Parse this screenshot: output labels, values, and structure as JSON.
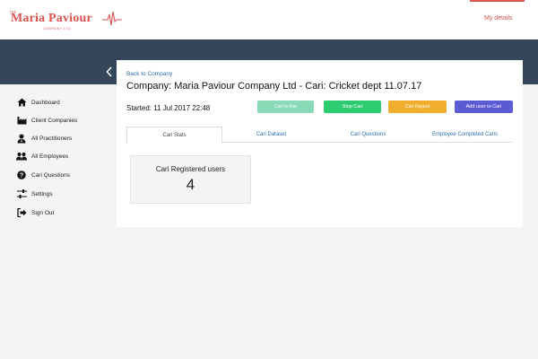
{
  "header": {
    "logo": {
      "the": "THE",
      "name": "Maria Paviour",
      "subtitle": "COMPANY LTD"
    },
    "my_details": "My details",
    "accent": "#d9534f"
  },
  "banner": {
    "color": "#34475a",
    "collapse_icon": "chevron-left-icon"
  },
  "sidebar": {
    "items": [
      {
        "label": "Dashboard",
        "icon": "home-icon"
      },
      {
        "label": "Client Companies",
        "icon": "industry-icon"
      },
      {
        "label": "All Practitioners",
        "icon": "user-tie-icon"
      },
      {
        "label": "All Employees",
        "icon": "users-icon"
      },
      {
        "label": "Cari Questions",
        "icon": "question-circle-icon"
      },
      {
        "label": "Settings",
        "icon": "sliders-icon"
      },
      {
        "label": "Sign Out",
        "icon": "sign-out-icon"
      }
    ]
  },
  "main": {
    "back_link": "Back to Company",
    "title": "Company: Maria Paviour Company Ltd - Cari: Cricket dept 11.07.17",
    "started": "Started: 11 Jul 2017 22:48",
    "buttons": {
      "live": "Cari is live",
      "stop": "Stop Cari",
      "report": "Cari Report",
      "add_user": "Add user to Cari"
    },
    "tabs": [
      {
        "label": "Cari Stats",
        "active": true
      },
      {
        "label": "Cari Dataset",
        "active": false
      },
      {
        "label": "Cari Questions",
        "active": false
      },
      {
        "label": "Employee Completed Caris",
        "active": false
      }
    ],
    "stat": {
      "label": "Cari Registered users",
      "value": "4"
    }
  }
}
